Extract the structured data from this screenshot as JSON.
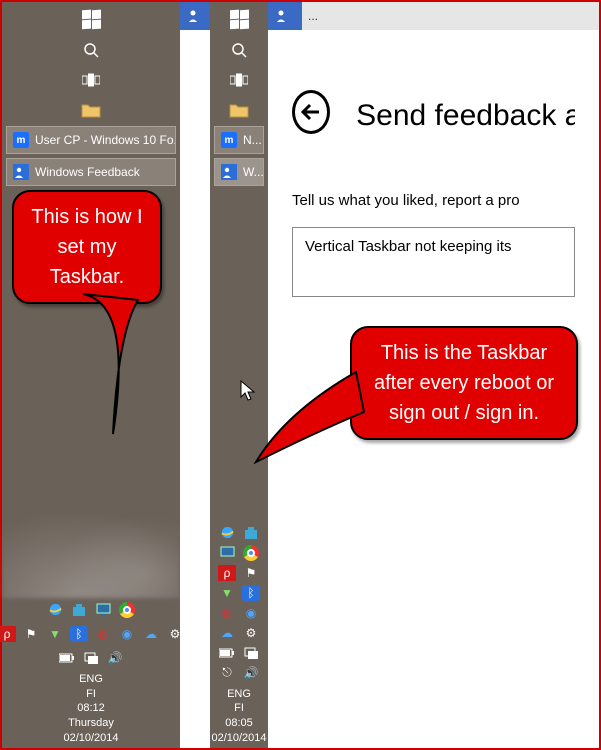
{
  "left_taskbar": {
    "tasks": [
      {
        "label": "User CP - Windows 10 Fo..."
      },
      {
        "label": "Windows Feedback"
      }
    ]
  },
  "narrow_taskbar": {
    "tasks": [
      {
        "label": "N..."
      },
      {
        "label": "W..."
      }
    ]
  },
  "clock_left": {
    "lang": "ENG",
    "region": "FI",
    "time": "08:12",
    "day": "Thursday",
    "date": "02/10/2014"
  },
  "clock_narrow": {
    "lang": "ENG",
    "region": "FI",
    "time": "08:05",
    "date": "02/10/2014"
  },
  "feedback": {
    "chrome_title": "...",
    "heading": "Send feedback abo",
    "subtext": "Tell us what you liked, report a pro",
    "input_value": "Vertical Taskbar not keeping its"
  },
  "callouts": {
    "c1": "This is how I set my Taskbar.",
    "c2": "This is the Taskbar after every reboot or sign out / sign in."
  }
}
